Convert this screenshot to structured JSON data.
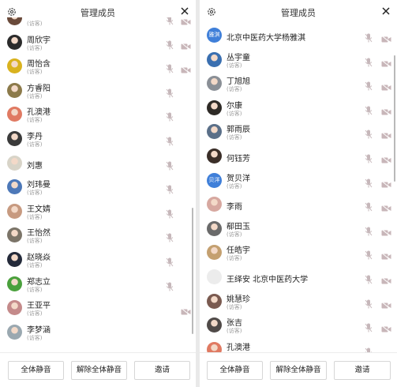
{
  "colors": {
    "accent_blue": "#3f7fd9",
    "mic_muted": "#c6b7ba",
    "cam_muted": "#c8b6b9"
  },
  "left_panel": {
    "title": "管理成员",
    "members": [
      {
        "name": "",
        "sub": "(访客)",
        "avatar": "photo",
        "avatar_color": "#6a4a3a",
        "avatar_text": "",
        "mic": true,
        "cam": true
      },
      {
        "name": "周欣宇",
        "sub": "(访客)",
        "avatar": "photo",
        "avatar_color": "#2b2b2b",
        "avatar_text": "",
        "mic": true,
        "cam": true
      },
      {
        "name": "周怡含",
        "sub": "(访客)",
        "avatar": "photo",
        "avatar_color": "#d9b21e",
        "avatar_text": "",
        "mic": true,
        "cam": true
      },
      {
        "name": "方睿阳",
        "sub": "(访客)",
        "avatar": "photo",
        "avatar_color": "#8c7a4a",
        "avatar_text": "",
        "mic": true,
        "cam": false
      },
      {
        "name": "孔澳港",
        "sub": "(访客)",
        "avatar": "photo",
        "avatar_color": "#e07a62",
        "avatar_text": "",
        "mic": true,
        "cam": false
      },
      {
        "name": "李丹",
        "sub": "(访客)",
        "avatar": "photo",
        "avatar_color": "#3a3a3a",
        "avatar_text": "",
        "mic": true,
        "cam": false
      },
      {
        "name": "刘惠",
        "sub": "",
        "avatar": "photo",
        "avatar_color": "#d8d4c8",
        "avatar_text": "",
        "mic": true,
        "cam": false
      },
      {
        "name": "刘玮曼",
        "sub": "(访客)",
        "avatar": "photo",
        "avatar_color": "#4d78b8",
        "avatar_text": "",
        "mic": true,
        "cam": false
      },
      {
        "name": "王文婧",
        "sub": "(访客)",
        "avatar": "photo",
        "avatar_color": "#c79a80",
        "avatar_text": "",
        "mic": true,
        "cam": false
      },
      {
        "name": "王怡然",
        "sub": "(访客)",
        "avatar": "photo",
        "avatar_color": "#7b7468",
        "avatar_text": "",
        "mic": true,
        "cam": false
      },
      {
        "name": "赵晓焱",
        "sub": "(访客)",
        "avatar": "photo",
        "avatar_color": "#242a3a",
        "avatar_text": "",
        "mic": true,
        "cam": false
      },
      {
        "name": "郑志立",
        "sub": "(访客)",
        "avatar": "photo",
        "avatar_color": "#4aa03c",
        "avatar_text": "",
        "mic": true,
        "cam": false
      },
      {
        "name": "王亚平",
        "sub": "(访客)",
        "avatar": "photo",
        "avatar_color": "#c48a8a",
        "avatar_text": "",
        "mic": false,
        "cam": true
      },
      {
        "name": "李梦涵",
        "sub": "(访客)",
        "avatar": "photo",
        "avatar_color": "#9aa8b0",
        "avatar_text": "",
        "mic": false,
        "cam": false
      }
    ],
    "buttons": {
      "mute_all": "全体静音",
      "unmute_all": "解除全体静音",
      "invite": "邀请"
    }
  },
  "right_panel": {
    "title": "管理成员",
    "members": [
      {
        "name": "北京中医药大学杨雅淇",
        "sub": "",
        "avatar": "text",
        "avatar_color": "#3f7fd9",
        "avatar_text": "雅淇",
        "mic": true,
        "cam": true
      },
      {
        "name": "丛宇童",
        "sub": "(访客)",
        "avatar": "photo",
        "avatar_color": "#3a6fb0",
        "avatar_text": "",
        "mic": true,
        "cam": true
      },
      {
        "name": "丁旭旭",
        "sub": "(访客)",
        "avatar": "photo",
        "avatar_color": "#8a8f96",
        "avatar_text": "",
        "mic": true,
        "cam": true
      },
      {
        "name": "尔康",
        "sub": "(访客)",
        "avatar": "photo",
        "avatar_color": "#2e2a26",
        "avatar_text": "",
        "mic": true,
        "cam": true
      },
      {
        "name": "郭雨辰",
        "sub": "(访客)",
        "avatar": "photo",
        "avatar_color": "#5a6f88",
        "avatar_text": "",
        "mic": true,
        "cam": true
      },
      {
        "name": "何钰芳",
        "sub": "",
        "avatar": "photo",
        "avatar_color": "#3a2e28",
        "avatar_text": "",
        "mic": true,
        "cam": true
      },
      {
        "name": "贺贝洋",
        "sub": "(访客)",
        "avatar": "text",
        "avatar_color": "#3f7fd9",
        "avatar_text": "贝洋",
        "mic": true,
        "cam": true
      },
      {
        "name": "李雨",
        "sub": "",
        "avatar": "photo",
        "avatar_color": "#d7a8a0",
        "avatar_text": "",
        "mic": true,
        "cam": true
      },
      {
        "name": "郗田玉",
        "sub": "(访客)",
        "avatar": "photo",
        "avatar_color": "#6a6a6a",
        "avatar_text": "",
        "mic": true,
        "cam": true
      },
      {
        "name": "任皓宇",
        "sub": "(访客)",
        "avatar": "photo",
        "avatar_color": "#c4a070",
        "avatar_text": "",
        "mic": true,
        "cam": true
      },
      {
        "name": "王绎安 北京中医药大学",
        "sub": "",
        "avatar": "blank",
        "avatar_color": "#ececec",
        "avatar_text": "",
        "mic": true,
        "cam": true
      },
      {
        "name": "姚慧珍",
        "sub": "(访客)",
        "avatar": "photo",
        "avatar_color": "#7a5a50",
        "avatar_text": "",
        "mic": true,
        "cam": true
      },
      {
        "name": "张吉",
        "sub": "(访客)",
        "avatar": "photo",
        "avatar_color": "#504a48",
        "avatar_text": "",
        "mic": true,
        "cam": true
      },
      {
        "name": "孔澳港",
        "sub": "(访客)",
        "avatar": "photo",
        "avatar_color": "#e07a62",
        "avatar_text": "",
        "mic": true,
        "cam": false
      }
    ],
    "buttons": {
      "mute_all": "全体静音",
      "unmute_all": "解除全体静音",
      "invite": "邀请"
    }
  }
}
